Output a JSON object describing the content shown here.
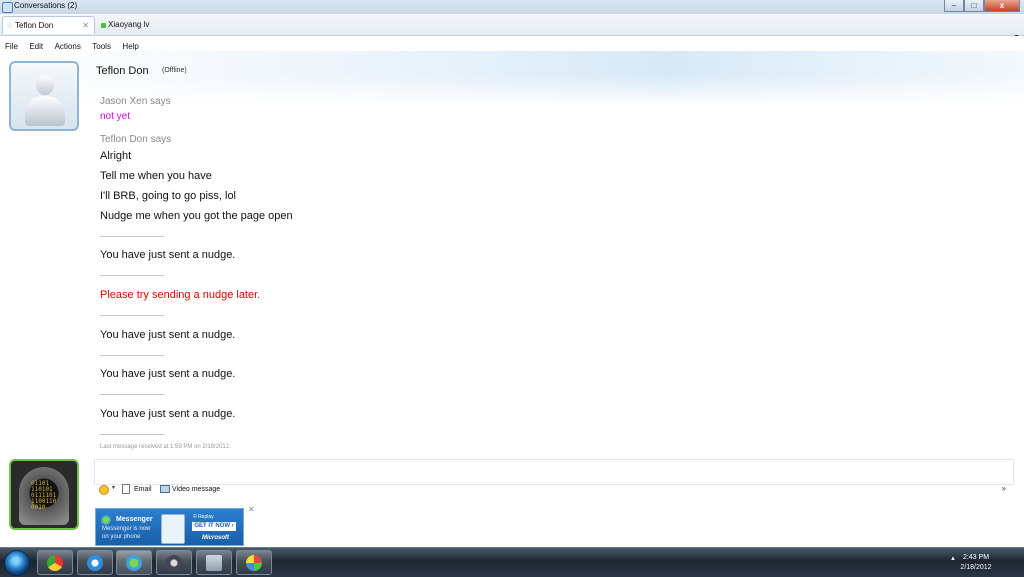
{
  "window": {
    "title": "Conversations (2)",
    "controls": {
      "minimize": "–",
      "maximize": "□",
      "close": "x"
    }
  },
  "tabs": [
    {
      "label": "Teflon Don",
      "active": true
    },
    {
      "label": "Xiaoyang lv",
      "active": false,
      "status_color": "#3ec43e"
    }
  ],
  "menu": [
    "File",
    "Edit",
    "Actions",
    "Tools",
    "Help"
  ],
  "contact": {
    "name": "Teflon Don",
    "status": "(Offline)"
  },
  "conversation": {
    "jason_says": "Jason Xen says",
    "jason_msg": "not yet",
    "teflon_says": "Teflon Don says",
    "teflon_msgs": [
      "Alright",
      "Tell me when you have",
      "I'll BRB, going to go piss, lol",
      "Nudge me when you got the page open"
    ],
    "system": [
      "You have just sent a nudge.",
      "Please try sending a nudge later.",
      "You have just sent a nudge.",
      "You have just sent a nudge.",
      "You have just sent a nudge."
    ],
    "last_message": "Last message received at 1:59 PM on 2/18/2012."
  },
  "compose_toolbar": {
    "email": "Email",
    "video": "Video message",
    "more": "»"
  },
  "ad": {
    "brand": "Messenger",
    "line1": "Messenger is now",
    "line2": "on your phone",
    "replay": "© Replay",
    "cta": "GET IT NOW ›",
    "vendor": "Microsoft"
  },
  "avatar_code": [
    "01101",
    "110101",
    "0111101",
    "1100110",
    "0010"
  ],
  "taskbar": {
    "time": "2:43 PM",
    "date": "2/18/2012"
  },
  "colors": {
    "system_error": "#e00000",
    "incoming_msg": "#e000e0",
    "online": "#3ec43e"
  }
}
